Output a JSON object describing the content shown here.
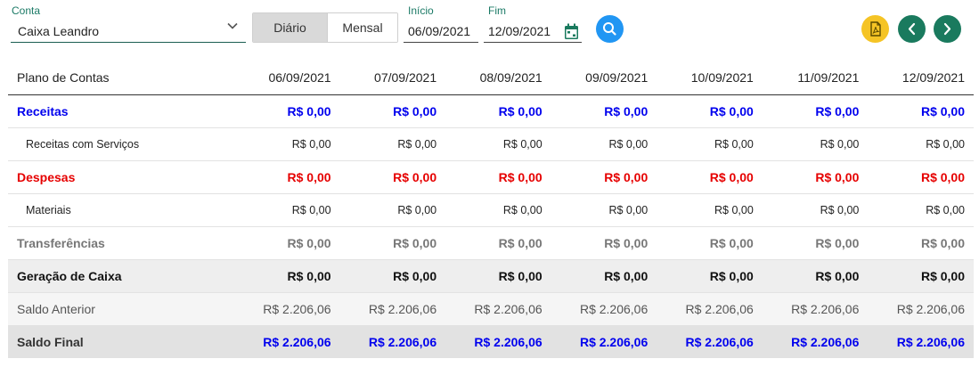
{
  "filters": {
    "conta_label": "Conta",
    "conta_value": "Caixa Leandro",
    "view_options": [
      "Diário",
      "Mensal"
    ],
    "selected_view": "Diário",
    "inicio_label": "Início",
    "inicio_value": "06/09/2021",
    "fim_label": "Fim",
    "fim_value": "12/09/2021"
  },
  "icons": {
    "search": "search-icon",
    "pdf": "pdf-icon",
    "prev": "chevron-left-icon",
    "next": "chevron-right-icon",
    "calendar": "calendar-icon"
  },
  "colors": {
    "accent_green": "#1a7a5e",
    "search_blue": "#2196f3",
    "pdf_yellow": "#f5c425",
    "receitas_blue": "#0000ee",
    "despesas_red": "#e60000"
  },
  "table": {
    "header": "Plano de Contas",
    "dates": [
      "06/09/2021",
      "07/09/2021",
      "08/09/2021",
      "09/09/2021",
      "10/09/2021",
      "11/09/2021",
      "12/09/2021"
    ],
    "rows": [
      {
        "name": "Receitas",
        "values": [
          "R$ 0,00",
          "R$ 0,00",
          "R$ 0,00",
          "R$ 0,00",
          "R$ 0,00",
          "R$ 0,00",
          "R$ 0,00"
        ]
      },
      {
        "name": "Receitas com Serviços",
        "values": [
          "R$ 0,00",
          "R$ 0,00",
          "R$ 0,00",
          "R$ 0,00",
          "R$ 0,00",
          "R$ 0,00",
          "R$ 0,00"
        ]
      },
      {
        "name": "Despesas",
        "values": [
          "R$ 0,00",
          "R$ 0,00",
          "R$ 0,00",
          "R$ 0,00",
          "R$ 0,00",
          "R$ 0,00",
          "R$ 0,00"
        ]
      },
      {
        "name": "Materiais",
        "values": [
          "R$ 0,00",
          "R$ 0,00",
          "R$ 0,00",
          "R$ 0,00",
          "R$ 0,00",
          "R$ 0,00",
          "R$ 0,00"
        ]
      },
      {
        "name": "Transferências",
        "values": [
          "R$ 0,00",
          "R$ 0,00",
          "R$ 0,00",
          "R$ 0,00",
          "R$ 0,00",
          "R$ 0,00",
          "R$ 0,00"
        ]
      },
      {
        "name": "Geração de Caixa",
        "values": [
          "R$ 0,00",
          "R$ 0,00",
          "R$ 0,00",
          "R$ 0,00",
          "R$ 0,00",
          "R$ 0,00",
          "R$ 0,00"
        ]
      },
      {
        "name": "Saldo Anterior",
        "values": [
          "R$ 2.206,06",
          "R$ 2.206,06",
          "R$ 2.206,06",
          "R$ 2.206,06",
          "R$ 2.206,06",
          "R$ 2.206,06",
          "R$ 2.206,06"
        ]
      },
      {
        "name": "Saldo Final",
        "values": [
          "R$ 2.206,06",
          "R$ 2.206,06",
          "R$ 2.206,06",
          "R$ 2.206,06",
          "R$ 2.206,06",
          "R$ 2.206,06",
          "R$ 2.206,06"
        ]
      }
    ]
  }
}
